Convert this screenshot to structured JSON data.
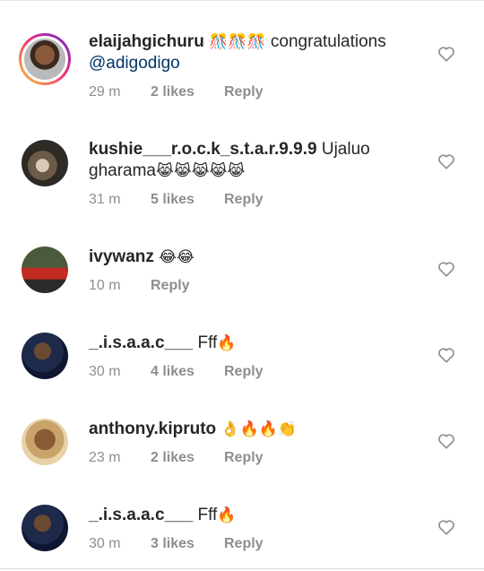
{
  "comments": [
    {
      "username": "elaijahgichuru",
      "text": "congratulations",
      "mention": "@adigodigo",
      "emojis": "🎊🎊🎊",
      "time": "29 m",
      "likes": "2 likes",
      "reply": "Reply"
    },
    {
      "username": "kushie___r.o.c.k_s.t.a.r.9.9.9",
      "text": "Ujaluo gharama",
      "emojis": "😹😹😹😹😹",
      "time": "31 m",
      "likes": "5 likes",
      "reply": "Reply"
    },
    {
      "username": "ivywanz",
      "text": "",
      "emojis": "😂😂",
      "time": "10 m",
      "likes": "",
      "reply": "Reply"
    },
    {
      "username": "_.i.s.a.a.c___",
      "text": "Fff",
      "emojis": "🔥",
      "time": "30 m",
      "likes": "4 likes",
      "reply": "Reply"
    },
    {
      "username": "anthony.kipruto",
      "text": "",
      "emojis": "👌🔥🔥👏",
      "time": "23 m",
      "likes": "2 likes",
      "reply": "Reply"
    },
    {
      "username": "_.i.s.a.a.c___",
      "text": "Fff",
      "emojis": "🔥",
      "time": "30 m",
      "likes": "3 likes",
      "reply": "Reply"
    }
  ],
  "icons": {
    "like": "heart-outline-icon"
  },
  "colors": {
    "username": "#262626",
    "meta": "#8e8e8e",
    "mention": "#003569",
    "story_ring": "#ee2a7b"
  }
}
